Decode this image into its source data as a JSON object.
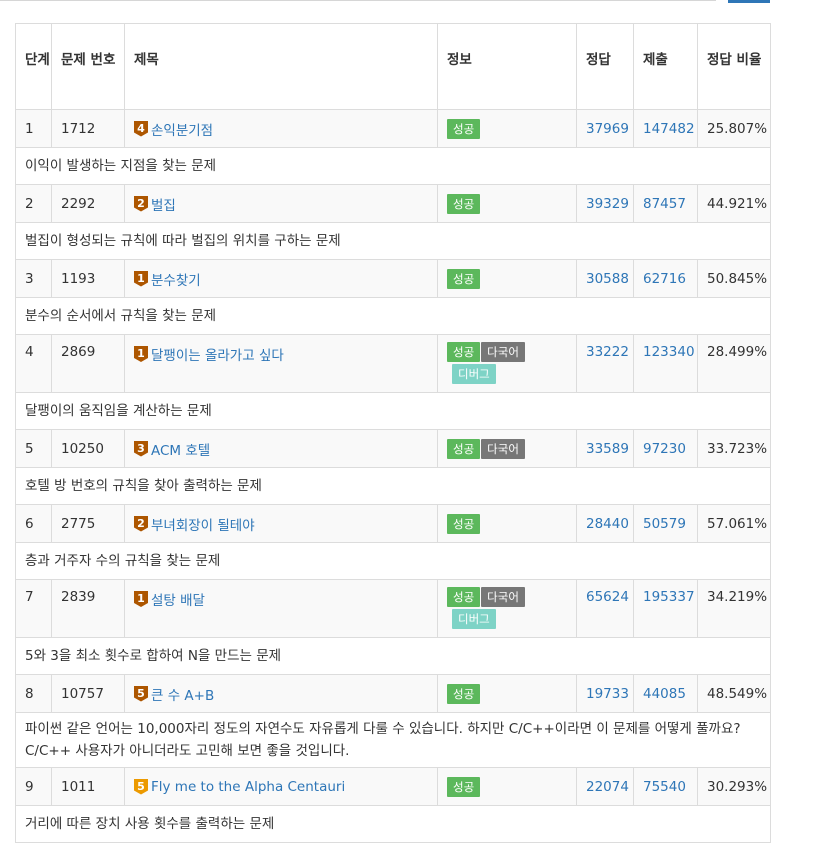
{
  "header": {
    "stage": "단계",
    "problem_id": "문제 번호",
    "title": "제목",
    "info": "정보",
    "correct": "정답",
    "submit": "제출",
    "ratio": "정답 비율"
  },
  "colors": {
    "link": "#2e76b7",
    "success": "#5cb85c",
    "multilang": "#777777",
    "debug": "#7ed3c6",
    "bronze": "#ad5600",
    "gold": "#ec9a00"
  },
  "rows": [
    {
      "stage": "1",
      "id": "1712",
      "tier": "4",
      "tier_icon": "bronze-tier-icon",
      "title": "손익분기점",
      "labels": [
        "성공"
      ],
      "labels2": [],
      "correct": "37969",
      "submit": "147482",
      "ratio": "25.807%",
      "desc": "이익이 발생하는 지점을 찾는 문제"
    },
    {
      "stage": "2",
      "id": "2292",
      "tier": "2",
      "tier_icon": "bronze-tier-icon",
      "title": "벌집",
      "labels": [
        "성공"
      ],
      "labels2": [],
      "correct": "39329",
      "submit": "87457",
      "ratio": "44.921%",
      "desc": "벌집이 형성되는 규칙에 따라 벌집의 위치를 구하는 문제"
    },
    {
      "stage": "3",
      "id": "1193",
      "tier": "1",
      "tier_icon": "bronze-tier-icon",
      "title": "분수찾기",
      "labels": [
        "성공"
      ],
      "labels2": [],
      "correct": "30588",
      "submit": "62716",
      "ratio": "50.845%",
      "desc": "분수의 순서에서 규칙을 찾는 문제"
    },
    {
      "stage": "4",
      "id": "2869",
      "tier": "1",
      "tier_icon": "bronze-tier-icon",
      "title": "달팽이는 올라가고 싶다",
      "labels": [
        "성공",
        "다국어"
      ],
      "labels2": [
        "디버그"
      ],
      "correct": "33222",
      "submit": "123340",
      "ratio": "28.499%",
      "desc": "달팽이의 움직임을 계산하는 문제"
    },
    {
      "stage": "5",
      "id": "10250",
      "tier": "3",
      "tier_icon": "bronze-tier-icon",
      "title": "ACM 호텔",
      "labels": [
        "성공",
        "다국어"
      ],
      "labels2": [],
      "correct": "33589",
      "submit": "97230",
      "ratio": "33.723%",
      "desc": "호텔 방 번호의 규칙을 찾아 출력하는 문제"
    },
    {
      "stage": "6",
      "id": "2775",
      "tier": "2",
      "tier_icon": "bronze-tier-icon",
      "title": "부녀회장이 될테야",
      "labels": [
        "성공"
      ],
      "labels2": [],
      "correct": "28440",
      "submit": "50579",
      "ratio": "57.061%",
      "desc": "층과 거주자 수의 규칙을 찾는 문제"
    },
    {
      "stage": "7",
      "id": "2839",
      "tier": "1",
      "tier_icon": "bronze-tier-icon",
      "title": "설탕 배달",
      "labels": [
        "성공",
        "다국어"
      ],
      "labels2": [
        "디버그"
      ],
      "correct": "65624",
      "submit": "195337",
      "ratio": "34.219%",
      "desc": "5와 3을 최소 횟수로 합하여 N을 만드는 문제"
    },
    {
      "stage": "8",
      "id": "10757",
      "tier": "5",
      "tier_icon": "bronze-tier-icon",
      "title": "큰 수 A+B",
      "labels": [
        "성공"
      ],
      "labels2": [],
      "correct": "19733",
      "submit": "44085",
      "ratio": "48.549%",
      "desc": "파이썬 같은 언어는 10,000자리 정도의 자연수도 자유롭게 다룰 수 있습니다. 하지만 C/C++이라면 이 문제를 어떻게 풀까요? C/C++ 사용자가 아니더라도 고민해 보면 좋을 것입니다."
    },
    {
      "stage": "9",
      "id": "1011",
      "tier": "5",
      "tier_icon": "gold-tier-icon",
      "title": "Fly me to the Alpha Centauri",
      "labels": [
        "성공"
      ],
      "labels2": [],
      "correct": "22074",
      "submit": "75540",
      "ratio": "30.293%",
      "desc": "거리에 따른 장치 사용 횟수를 출력하는 문제"
    }
  ]
}
